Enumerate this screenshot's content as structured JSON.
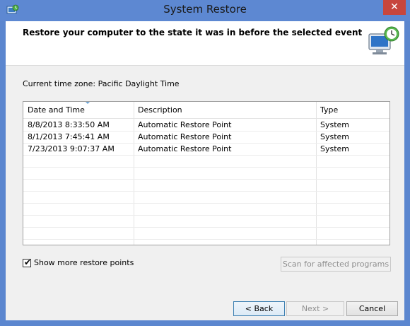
{
  "window": {
    "title": "System Restore",
    "close_glyph": "✕"
  },
  "header": {
    "heading": "Restore your computer to the state it was in before the selected event"
  },
  "timezone": {
    "label": "Current time zone: Pacific Daylight Time"
  },
  "table": {
    "columns": [
      "Date and Time",
      "Description",
      "Type"
    ],
    "rows": [
      [
        "8/8/2013 8:33:50 AM",
        "Automatic Restore Point",
        "System"
      ],
      [
        "8/1/2013 7:45:41 AM",
        "Automatic Restore Point",
        "System"
      ],
      [
        "7/23/2013 9:07:37 AM",
        "Automatic Restore Point",
        "System"
      ]
    ]
  },
  "options": {
    "show_more_label": "Show more restore points",
    "show_more_checked": true,
    "check_glyph": "✔",
    "scan_label": "Scan for affected programs"
  },
  "footer": {
    "back_label": "< Back",
    "next_label": "Next >",
    "cancel_label": "Cancel"
  },
  "icons": {
    "app": "system-restore-icon",
    "header": "computer-clock-icon"
  },
  "colors": {
    "title_bar": "#5d88d2",
    "close": "#c7463d"
  }
}
